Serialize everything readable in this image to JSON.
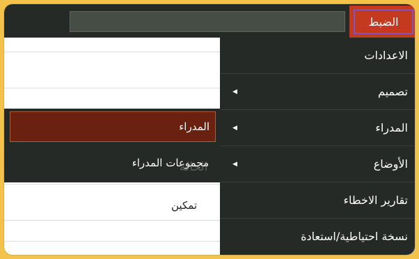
{
  "topbar": {
    "menu_label": "الضبط"
  },
  "main_menu": {
    "items": [
      {
        "label": "الاعدادات",
        "has_submenu": false
      },
      {
        "label": "تصميم",
        "has_submenu": true
      },
      {
        "label": "المدراء",
        "has_submenu": true
      },
      {
        "label": "الأوضاع",
        "has_submenu": true
      },
      {
        "label": "تقارير الاخطاء",
        "has_submenu": false
      },
      {
        "label": "نسخة احتياطية/استعادة",
        "has_submenu": false
      }
    ]
  },
  "submenu": {
    "items": [
      {
        "label": "المدراء",
        "active": true
      },
      {
        "label": "مجموعات المدراء",
        "active": false
      }
    ]
  },
  "background": {
    "ghost_label": "الحالة",
    "status_value": "تمكين"
  }
}
